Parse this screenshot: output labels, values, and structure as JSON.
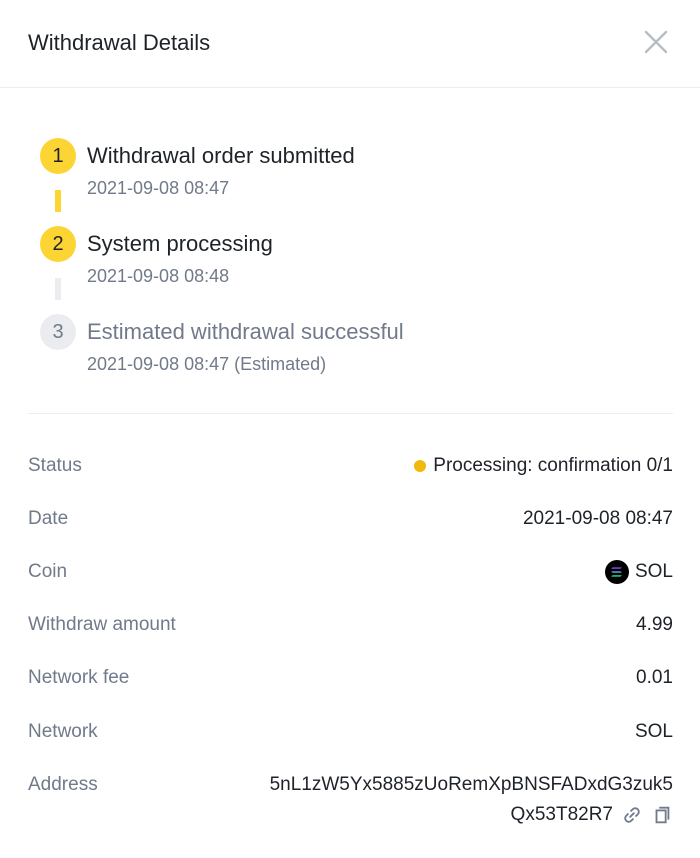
{
  "header": {
    "title": "Withdrawal Details",
    "close_icon": "close-icon"
  },
  "steps": [
    {
      "number": "1",
      "title": "Withdrawal order submitted",
      "time": "2021-09-08 08:47",
      "state": "done"
    },
    {
      "number": "2",
      "title": "System processing",
      "time": "2021-09-08 08:48",
      "state": "done"
    },
    {
      "number": "3",
      "title": "Estimated withdrawal successful",
      "time": "2021-09-08 08:47 (Estimated)",
      "state": "pending"
    }
  ],
  "details": {
    "status": {
      "label": "Status",
      "value": "Processing: confirmation 0/1"
    },
    "date": {
      "label": "Date",
      "value": "2021-09-08 08:47"
    },
    "coin": {
      "label": "Coin",
      "value": "SOL",
      "icon": "solana-coin-icon"
    },
    "amount": {
      "label": "Withdraw amount",
      "value": "4.99"
    },
    "fee": {
      "label": "Network fee",
      "value": "0.01"
    },
    "network": {
      "label": "Network",
      "value": "SOL"
    },
    "address": {
      "label": "Address",
      "value_line1": "5nL1zW5Yx5885zUoRemXpBNSFADxdG3zuk5",
      "value_line2": "Qx53T82R7",
      "link_icon": "link-icon",
      "copy_icon": "copy-icon"
    }
  },
  "colors": {
    "accent": "#fcd535",
    "status_dot": "#f0b90b",
    "muted_text": "#707a8a",
    "primary_text": "#1e2329",
    "divider": "#eaecef"
  }
}
